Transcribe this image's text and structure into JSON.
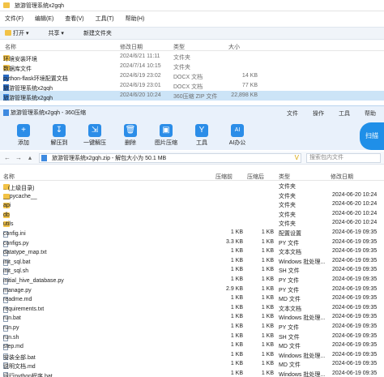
{
  "explorer": {
    "breadcrumb": "旅游管理系统x2gqh",
    "menu": [
      "文件(F)",
      "编辑(E)",
      "查看(V)",
      "工具(T)",
      "帮助(H)"
    ],
    "toolbar": [
      "打开",
      "共享",
      "新建文件夹"
    ],
    "columns": {
      "name": "名称",
      "date": "修改日期",
      "type": "类型",
      "size": "大小"
    },
    "rows": [
      {
        "name": "环境安装环境",
        "date": "2024/6/21 11:11",
        "type": "文件夹",
        "size": "",
        "icon": "folder"
      },
      {
        "name": "数据库文件",
        "date": "2024/7/14 10:15",
        "type": "文件夹",
        "size": "",
        "icon": "folder"
      },
      {
        "name": "python-flask环境配置文档",
        "date": "2024/6/19 23:02",
        "type": "DOCX 文档",
        "size": "14 KB",
        "icon": "word"
      },
      {
        "name": "旅游管理系统x2gqh",
        "date": "2024/6/19 23:01",
        "type": "DOCX 文档",
        "size": "77 KB",
        "icon": "word"
      },
      {
        "name": "旅游管理系统x2gqh",
        "date": "2024/6/20 10:24",
        "type": "360压缩 ZIP 文件",
        "size": "22,898 KB",
        "icon": "zip"
      }
    ]
  },
  "zip": {
    "title": "旅游管理系统x2gqh - 360压缩",
    "menus": [
      "文件",
      "操作",
      "工具",
      "帮助"
    ],
    "tools": [
      {
        "label": "添加",
        "icon": "+"
      },
      {
        "label": "解压到",
        "icon": "↧"
      },
      {
        "label": "一键解压",
        "icon": "⇲"
      },
      {
        "label": "删除",
        "icon": "🗑"
      },
      {
        "label": "图片压缩",
        "icon": "▣"
      },
      {
        "label": "工具",
        "icon": "Y"
      },
      {
        "label": "AI办公",
        "icon": "AI"
      }
    ],
    "scan_label": "扫描",
    "path": "旅游管理系统x2gqh.zip - 解包大小为 50.1 MB",
    "search_placeholder": "搜索包内文件",
    "columns": {
      "name": "名称",
      "packed": "压缩前",
      "size": "压缩后",
      "type": "类型",
      "date": "修改日期"
    },
    "rows": [
      {
        "name": ".. (上级目录)",
        "packed": "",
        "size": "",
        "type": "文件夹",
        "date": "",
        "icon": "folder"
      },
      {
        "name": "__pycache__",
        "packed": "",
        "size": "",
        "type": "文件夹",
        "date": "2024-06-20 10:24",
        "icon": "folder"
      },
      {
        "name": "api",
        "packed": "",
        "size": "",
        "type": "文件夹",
        "date": "2024-06-20 10:24",
        "icon": "folder"
      },
      {
        "name": "db",
        "packed": "",
        "size": "",
        "type": "文件夹",
        "date": "2024-06-20 10:24",
        "icon": "folder"
      },
      {
        "name": "utils",
        "packed": "",
        "size": "",
        "type": "文件夹",
        "date": "2024-06-20 10:24",
        "icon": "folder"
      },
      {
        "name": "config.ini",
        "packed": "1 KB",
        "size": "1 KB",
        "type": "配置设置",
        "date": "2024-06-19 09:35",
        "icon": "doc"
      },
      {
        "name": "configs.py",
        "packed": "3.3 KB",
        "size": "1 KB",
        "type": "PY 文件",
        "date": "2024-06-19 09:35",
        "icon": "doc"
      },
      {
        "name": "datatype_map.txt",
        "packed": "1 KB",
        "size": "1 KB",
        "type": "文本文档",
        "date": "2024-06-19 09:35",
        "icon": "doc"
      },
      {
        "name": "init_sql.bat",
        "packed": "1 KB",
        "size": "1 KB",
        "type": "Windows 批处理...",
        "date": "2024-06-19 09:35",
        "icon": "doc"
      },
      {
        "name": "init_sql.sh",
        "packed": "1 KB",
        "size": "1 KB",
        "type": "SH 文件",
        "date": "2024-06-19 09:35",
        "icon": "doc"
      },
      {
        "name": "initial_hive_database.py",
        "packed": "1 KB",
        "size": "1 KB",
        "type": "PY 文件",
        "date": "2024-06-19 09:35",
        "icon": "doc"
      },
      {
        "name": "manage.py",
        "packed": "2.9 KB",
        "size": "1 KB",
        "type": "PY 文件",
        "date": "2024-06-19 09:35",
        "icon": "doc"
      },
      {
        "name": "readme.md",
        "packed": "1 KB",
        "size": "1 KB",
        "type": "MD 文件",
        "date": "2024-06-19 09:35",
        "icon": "doc"
      },
      {
        "name": "requirements.txt",
        "packed": "1 KB",
        "size": "1 KB",
        "type": "文本文档",
        "date": "2024-06-19 09:35",
        "icon": "doc"
      },
      {
        "name": "run.bat",
        "packed": "1 KB",
        "size": "1 KB",
        "type": "Windows 批处理...",
        "date": "2024-06-19 09:35",
        "icon": "doc"
      },
      {
        "name": "run.py",
        "packed": "1 KB",
        "size": "1 KB",
        "type": "PY 文件",
        "date": "2024-06-19 09:35",
        "icon": "doc"
      },
      {
        "name": "run.sh",
        "packed": "1 KB",
        "size": "1 KB",
        "type": "SH 文件",
        "date": "2024-06-19 09:35",
        "icon": "doc"
      },
      {
        "name": "step.md",
        "packed": "1 KB",
        "size": "1 KB",
        "type": "MD 文件",
        "date": "2024-06-19 09:35",
        "icon": "doc"
      },
      {
        "name": "安装全部.bat",
        "packed": "1 KB",
        "size": "1 KB",
        "type": "Windows 批处理...",
        "date": "2024-06-19 09:35",
        "icon": "doc"
      },
      {
        "name": "说明文档.md",
        "packed": "1 KB",
        "size": "1 KB",
        "type": "MD 文件",
        "date": "2024-06-19 09:35",
        "icon": "doc"
      },
      {
        "name": "运行python程序.bat",
        "packed": "1 KB",
        "size": "1 KB",
        "type": "Windows 批处理...",
        "date": "2024-06-19 09:35",
        "icon": "doc"
      }
    ]
  }
}
